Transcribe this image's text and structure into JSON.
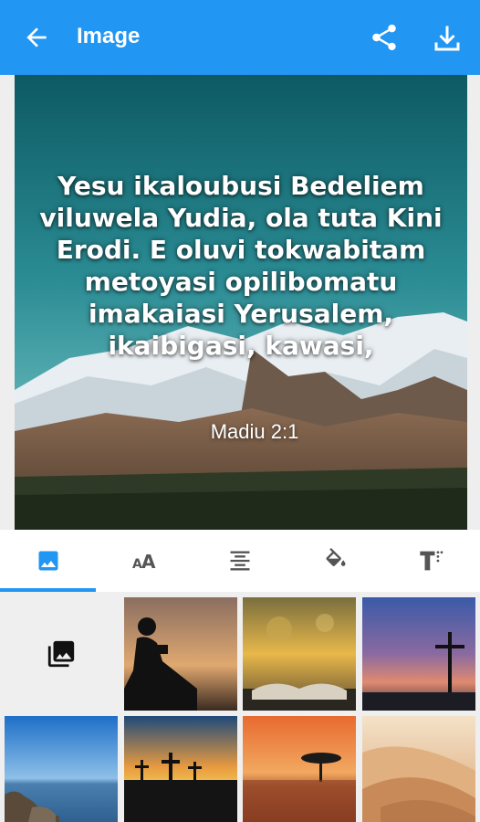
{
  "app_bar": {
    "title": "Image",
    "icons": [
      "arrow-back-icon",
      "share-icon",
      "download-icon"
    ],
    "color": "#2196f3"
  },
  "preview": {
    "verse": "Yesu ikaloubusi Bedeliem viluwela Yudia, ola tuta Kini Erodi. E oluvi tokwabitam metoyasi opilibomatu imakaiasi Yerusalem, ikaibigasi, kawasi,",
    "reference": "Madiu 2:1"
  },
  "tabs": [
    {
      "icon": "image-icon",
      "active": true
    },
    {
      "icon": "font-size-icon",
      "active": false
    },
    {
      "icon": "align-center-icon",
      "active": false
    },
    {
      "icon": "paint-bucket-icon",
      "active": false
    },
    {
      "icon": "text-style-icon",
      "active": false
    }
  ],
  "backgrounds": {
    "gallery_icon": "photo-library-icon",
    "thumbnails": [
      "person-reading-silhouette-sunset",
      "open-bible-golden-bokeh",
      "cross-silhouette-dusk",
      "lake-rocks-blue-sky",
      "three-crosses-sunset",
      "savanna-tree-sunset",
      "desert-dunes"
    ]
  }
}
